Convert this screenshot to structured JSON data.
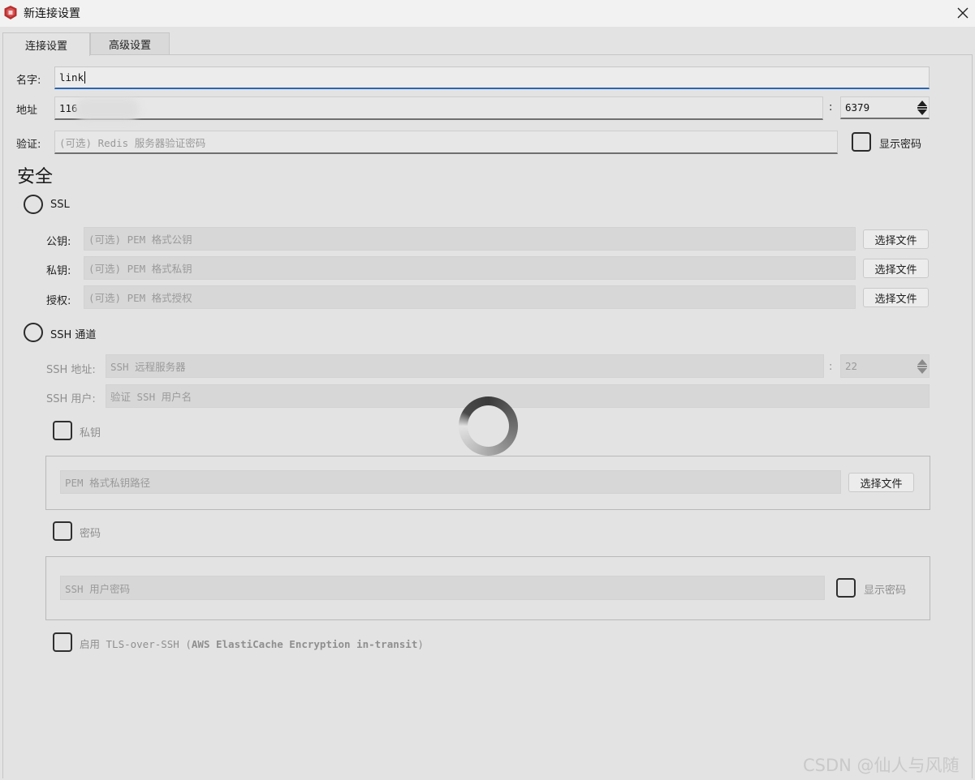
{
  "window": {
    "title": "新连接设置",
    "app_icon": "redis-app-icon",
    "close_icon": "close-icon"
  },
  "tabs": [
    {
      "label": "连接设置",
      "active": true
    },
    {
      "label": "高级设置",
      "active": false
    }
  ],
  "connection": {
    "name_label": "名字:",
    "name_value": "link",
    "address_label": "地址",
    "address_value": "116",
    "port_separator": ":",
    "port_value": "6379",
    "auth_label": "验证:",
    "auth_placeholder": "(可选) Redis 服务器验证密码",
    "show_password_label": "显示密码"
  },
  "security": {
    "heading": "安全",
    "ssl": {
      "label": "SSL",
      "public_key_label": "公钥:",
      "public_key_placeholder": "(可选) PEM 格式公钥",
      "private_key_label": "私钥:",
      "private_key_placeholder": "(可选) PEM 格式私钥",
      "authority_label": "授权:",
      "authority_placeholder": "(可选) PEM 格式授权",
      "choose_file_label": "选择文件"
    },
    "ssh": {
      "label": "SSH 通道",
      "address_label": "SSH 地址:",
      "address_placeholder": "SSH 远程服务器",
      "port_separator": ":",
      "port_value": "22",
      "user_label": "SSH 用户:",
      "user_placeholder": "验证 SSH 用户名",
      "private_key_label": "私钥",
      "private_key_path_placeholder": "PEM 格式私钥路径",
      "choose_file_label": "选择文件",
      "password_label": "密码",
      "password_placeholder": "SSH 用户密码",
      "show_password_label": "显示密码",
      "tls_over_ssh_prefix": "启用 TLS-over-SSH (",
      "tls_over_ssh_bold": "AWS ElastiCache Encryption in-transit",
      "tls_over_ssh_suffix": ")"
    }
  },
  "loading_spinner": "loading-spinner-icon",
  "watermark": "CSDN @仙人与风随"
}
